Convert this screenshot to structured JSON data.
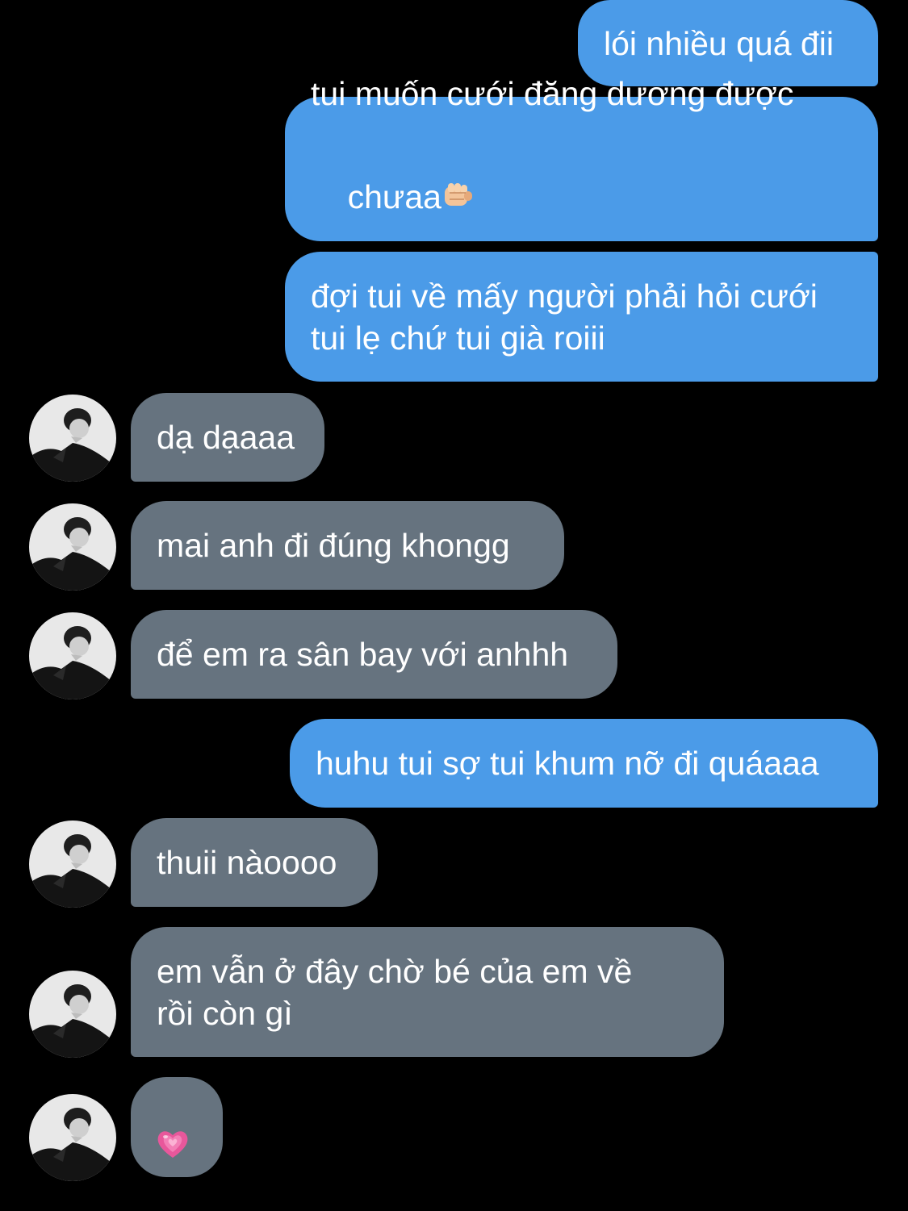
{
  "messages": [
    {
      "id": "m1",
      "side": "out",
      "lines": [
        "lói nhiều quá đii"
      ]
    },
    {
      "id": "m2",
      "side": "out",
      "lines": [
        "tui muốn cưới đăng dương được",
        "chưaa"
      ],
      "emoji": "fist-bump-emoji"
    },
    {
      "id": "m3",
      "side": "out",
      "lines": [
        "đợi tui về mấy người phải hỏi cưới",
        "tui lẹ chứ tui già roiii"
      ]
    },
    {
      "id": "m4",
      "side": "in",
      "lines": [
        "dạ dạaaa"
      ]
    },
    {
      "id": "m5",
      "side": "in",
      "lines": [
        "mai anh đi đúng khongg"
      ]
    },
    {
      "id": "m6",
      "side": "in",
      "lines": [
        "để em ra sân bay với anhhh"
      ]
    },
    {
      "id": "m7",
      "side": "out",
      "lines": [
        "huhu tui sợ tui khum nỡ đi quáaaa"
      ]
    },
    {
      "id": "m8",
      "side": "in",
      "lines": [
        "thuii nàoooo"
      ]
    },
    {
      "id": "m9",
      "side": "in",
      "lines": [
        "em vẫn ở đây chờ bé của em về",
        "rồi còn gì"
      ]
    },
    {
      "id": "m10",
      "side": "in",
      "lines": [],
      "emoji": "growing-heart-emoji"
    }
  ],
  "colors": {
    "background": "#000000",
    "outgoing_bubble": "#4b9be8",
    "incoming_bubble": "#66737f",
    "text": "#ffffff",
    "heart": "#e8579b"
  },
  "icons": {
    "avatar": "contact-avatar-photo",
    "fist": "fist-bump-emoji",
    "heart": "growing-heart-emoji"
  }
}
